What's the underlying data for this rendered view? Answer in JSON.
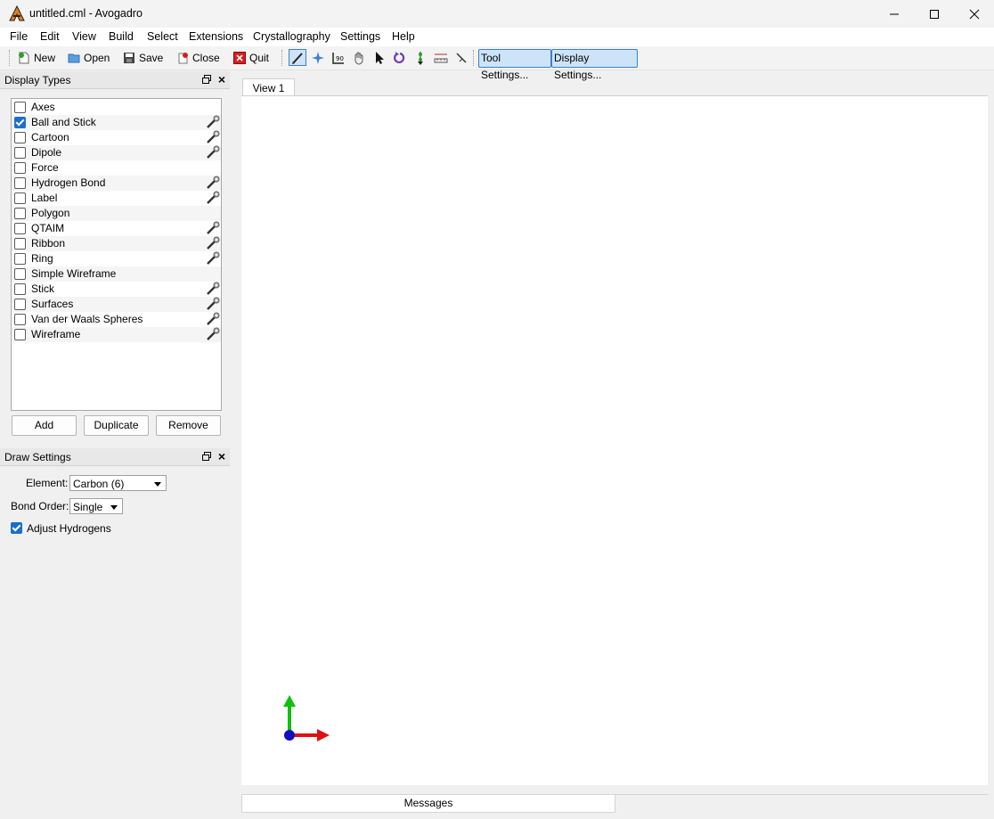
{
  "window": {
    "title": "untitled.cml - Avogadro"
  },
  "menu": [
    "File",
    "Edit",
    "View",
    "Build",
    "Select",
    "Extensions",
    "Crystallography",
    "Settings",
    "Help"
  ],
  "toolbar": {
    "new": "New",
    "open": "Open",
    "save": "Save",
    "close": "Close",
    "quit": "Quit",
    "tool_settings": "Tool Settings...",
    "display_settings": "Display Settings..."
  },
  "display_types": {
    "title": "Display Types",
    "items": [
      {
        "label": "Axes",
        "checked": false
      },
      {
        "label": "Ball and Stick",
        "checked": true
      },
      {
        "label": "Cartoon",
        "checked": false
      },
      {
        "label": "Dipole",
        "checked": false
      },
      {
        "label": "Force",
        "checked": false
      },
      {
        "label": "Hydrogen Bond",
        "checked": false
      },
      {
        "label": "Label",
        "checked": false
      },
      {
        "label": "Polygon",
        "checked": false
      },
      {
        "label": "QTAIM",
        "checked": false
      },
      {
        "label": "Ribbon",
        "checked": false
      },
      {
        "label": "Ring",
        "checked": false
      },
      {
        "label": "Simple Wireframe",
        "checked": false
      },
      {
        "label": "Stick",
        "checked": false
      },
      {
        "label": "Surfaces",
        "checked": false
      },
      {
        "label": "Van der Waals Spheres",
        "checked": false
      },
      {
        "label": "Wireframe",
        "checked": false
      }
    ],
    "add": "Add",
    "duplicate": "Duplicate",
    "remove": "Remove"
  },
  "draw_settings": {
    "title": "Draw Settings",
    "element_label": "Element:",
    "element_value": "Carbon (6)",
    "bond_order_label": "Bond Order:",
    "bond_order_value": "Single",
    "adjust_hydrogens_label": "Adjust Hydrogens",
    "adjust_hydrogens_checked": true
  },
  "view": {
    "tab": "View 1"
  },
  "messages": {
    "tab": "Messages"
  },
  "colors": {
    "accent": "#1a6fc9",
    "axis_x": "#e01010",
    "axis_y": "#10c010",
    "axis_z": "#1010c0"
  }
}
